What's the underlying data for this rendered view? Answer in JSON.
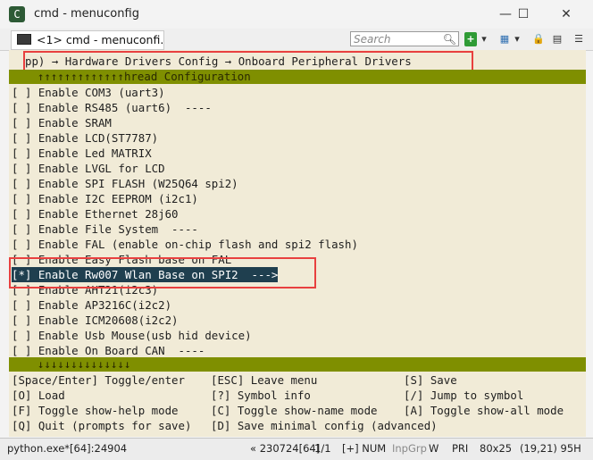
{
  "window": {
    "title": "cmd - menuconfig",
    "icon_glyph": "C"
  },
  "controls": {
    "minimize": "—",
    "maximize": "☐",
    "close": "✕"
  },
  "tab": {
    "label": "<1> cmd - menuconfi..."
  },
  "search": {
    "placeholder": "Search"
  },
  "toolbar": {
    "add": "+",
    "dropdown": "▾",
    "view": "▦",
    "lock": "🔒",
    "menu": "☰"
  },
  "terminal": {
    "breadcrumb": "pp) → Hardware Drivers Config → Onboard Peripheral Drivers",
    "title_bar": "↑↑↑↑↑↑↑↑↑↑↑↑↑hread Configuration",
    "items": [
      "[ ] Enable COM3 (uart3)",
      "[ ] Enable RS485 (uart6)  ----",
      "[ ] Enable SRAM",
      "[ ] Enable LCD(ST7787)",
      "[ ] Enable Led MATRIX",
      "[ ] Enable LVGL for LCD",
      "[ ] Enable SPI FLASH (W25Q64 spi2)",
      "[ ] Enable I2C EEPROM (i2c1)",
      "[ ] Enable Ethernet 28j60",
      "[ ] Enable File System  ----",
      "[ ] Enable FAL (enable on-chip flash and spi2 flash)",
      "[ ] Enable Easy Flash base on FAL",
      "[*] Enable Rw007 Wlan Base on SPI2  --->",
      "[ ] Enable AHT21(i2c3)",
      "[ ] Enable AP3216C(i2c2)",
      "[ ] Enable ICM20608(i2c2)",
      "[ ] Enable Usb Mouse(usb hid device)",
      "[ ] Enable On Board CAN  ----"
    ],
    "selected_index": 12,
    "bottom_bar": "↓↓↓↓↓↓↓↓↓↓↓↓↓↓",
    "help": [
      [
        "[Space/Enter] Toggle/enter",
        "[ESC] Leave menu",
        "[S] Save"
      ],
      [
        "[O] Load",
        "[?] Symbol info",
        "[/] Jump to symbol"
      ],
      [
        "[F] Toggle show-help mode",
        "[C] Toggle show-name mode",
        "[A] Toggle show-all mode"
      ],
      [
        "[Q] Quit (prompts for save)",
        "[D] Save minimal config (advanced)",
        ""
      ]
    ]
  },
  "status": {
    "process": "python.exe*[64]:24904",
    "build": "« 230724[64]",
    "pos": "1/1",
    "mode": "[+] NUM",
    "input": "InpGrp",
    "w": "W",
    "pri": "PRI",
    "size": "80x25",
    "cursor": "(19,21) 95H"
  },
  "colors": {
    "terminal_bg": "#f1ebd7",
    "olive": "#7f8f00",
    "selection": "#1f3f4f",
    "highlight": "#e8403f"
  }
}
